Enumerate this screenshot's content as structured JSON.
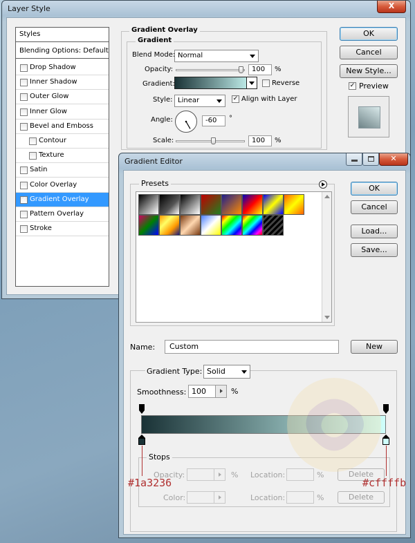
{
  "layer_style": {
    "title": "Layer Style",
    "close_label": "X",
    "styles_header": "Styles",
    "blending_options": "Blending Options: Default",
    "effects": [
      {
        "label": "Drop Shadow",
        "checked": false,
        "sub": false
      },
      {
        "label": "Inner Shadow",
        "checked": false,
        "sub": false
      },
      {
        "label": "Outer Glow",
        "checked": false,
        "sub": false
      },
      {
        "label": "Inner Glow",
        "checked": false,
        "sub": false
      },
      {
        "label": "Bevel and Emboss",
        "checked": false,
        "sub": false
      },
      {
        "label": "Contour",
        "checked": false,
        "sub": true
      },
      {
        "label": "Texture",
        "checked": false,
        "sub": true
      },
      {
        "label": "Satin",
        "checked": false,
        "sub": false
      },
      {
        "label": "Color Overlay",
        "checked": false,
        "sub": false
      },
      {
        "label": "Gradient Overlay",
        "checked": true,
        "sub": false,
        "selected": true
      },
      {
        "label": "Pattern Overlay",
        "checked": false,
        "sub": false
      },
      {
        "label": "Stroke",
        "checked": false,
        "sub": false
      }
    ],
    "group_title": "Gradient Overlay",
    "subgroup_title": "Gradient",
    "blend_mode_label": "Blend Mode:",
    "blend_mode_value": "Normal",
    "opacity_label": "Opacity:",
    "opacity_value": "100",
    "opacity_pct": 100,
    "percent": "%",
    "gradient_label": "Gradient:",
    "reverse_label": "Reverse",
    "reverse_checked": false,
    "style_label": "Style:",
    "style_value": "Linear",
    "align_label": "Align with Layer",
    "align_checked": true,
    "angle_label": "Angle:",
    "angle_value": "-60",
    "angle_deg": -60,
    "degree": "°",
    "scale_label": "Scale:",
    "scale_value": "100",
    "scale_pct": 100,
    "ok_label": "OK",
    "cancel_label": "Cancel",
    "new_style_label": "New Style...",
    "preview_label": "Preview",
    "preview_checked": true
  },
  "gradient_editor": {
    "title": "Gradient Editor",
    "presets_title": "Presets",
    "ok_label": "OK",
    "cancel_label": "Cancel",
    "load_label": "Load...",
    "save_label": "Save...",
    "name_label": "Name:",
    "name_value": "Custom",
    "new_label": "New",
    "gradient_type_label": "Gradient Type:",
    "gradient_type_value": "Solid",
    "smoothness_label": "Smoothness:",
    "smoothness_value": "100",
    "percent": "%",
    "stops_title": "Stops",
    "opacity_label": "Opacity:",
    "location_label": "Location:",
    "delete_label": "Delete",
    "color_label": "Color:",
    "stop_left_color": "#1a3236",
    "stop_right_color": "#cffffb",
    "annotation_left": "#1a3236",
    "annotation_right": "#cffffb",
    "annotation_color": "#b03030",
    "presets": [
      "linear-gradient(135deg,#000,#fff)",
      "linear-gradient(135deg,#000,#555 60%,rgba(0,0,0,0))",
      "linear-gradient(135deg,#000,#fff)",
      "linear-gradient(135deg,#c00000,#208020)",
      "linear-gradient(135deg,#1e1e8c,#ff8c00)",
      "linear-gradient(135deg,#0000c0,#ff0000,#ffff00)",
      "linear-gradient(135deg,#0000ff,#ffff00,#0000ff)",
      "linear-gradient(135deg,#ff6000,#ffff00,#ff6000)",
      "linear-gradient(135deg,#d00060,#008000,#0000ff)",
      "linear-gradient(135deg,#ff9900,#ffff66,#ff9900,#1a1a80)",
      "linear-gradient(135deg,#7a3b12,#ffd7b0,#7a3b12)",
      "linear-gradient(135deg,#4a7fff,#ffffff,#ffff00)",
      "linear-gradient(135deg,#ff0000,#ffff00,#00ff00,#00ffff,#0000ff,#ff00ff)",
      "linear-gradient(135deg,#ff0000,#ffff00,#00ff00,#00ffff,#0000ff,#ff00ff,#ff0000)",
      "repeating-linear-gradient(135deg,#000 0 3px,#444 3px 6px)"
    ]
  }
}
